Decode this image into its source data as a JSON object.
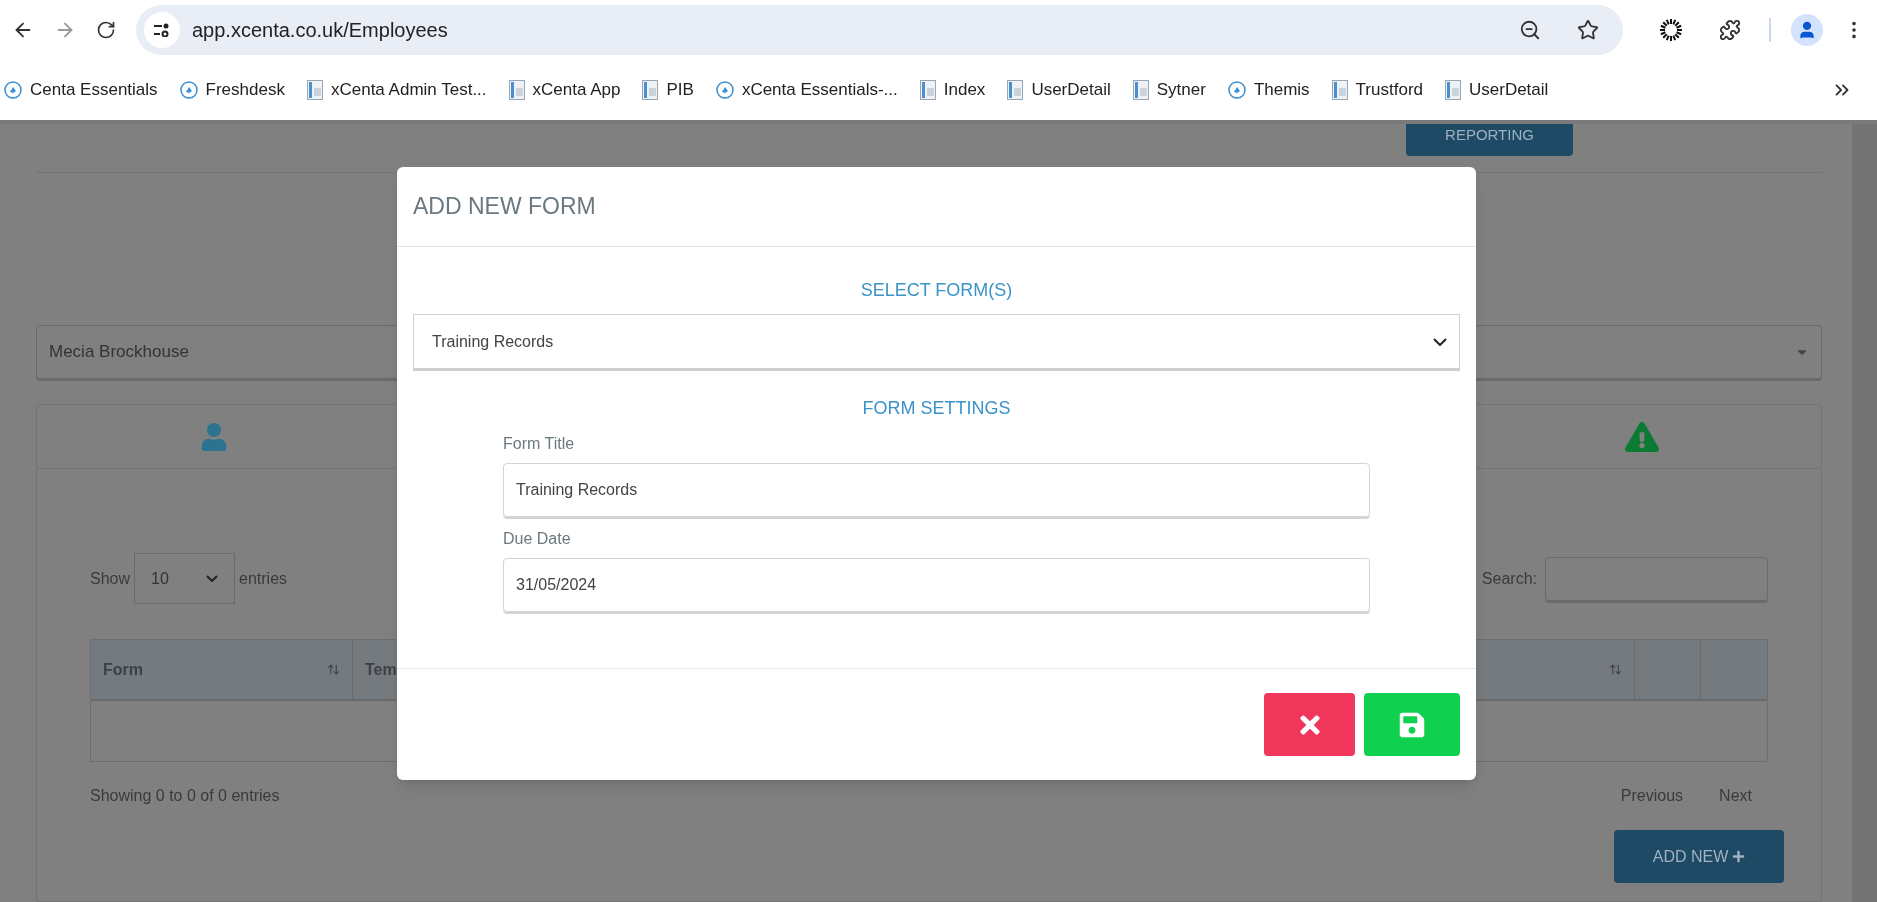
{
  "browser": {
    "url": "app.xcenta.co.uk/Employees",
    "bookmarks": [
      {
        "label": "Centa Essentials",
        "kind": "site"
      },
      {
        "label": "Freshdesk",
        "kind": "site"
      },
      {
        "label": "xCenta Admin Test...",
        "kind": "page"
      },
      {
        "label": "xCenta App",
        "kind": "page"
      },
      {
        "label": "PIB",
        "kind": "page"
      },
      {
        "label": "xCenta Essentials-...",
        "kind": "site"
      },
      {
        "label": "Index",
        "kind": "page"
      },
      {
        "label": "UserDetail",
        "kind": "page"
      },
      {
        "label": "Sytner",
        "kind": "page"
      },
      {
        "label": "Themis",
        "kind": "site"
      },
      {
        "label": "Trustford",
        "kind": "page"
      },
      {
        "label": "UserDetail",
        "kind": "page"
      }
    ]
  },
  "page": {
    "reporting_button": "REPORTING",
    "employee_select": "Mecia Brockhouse",
    "table": {
      "show_label": "Show",
      "page_size": "10",
      "entries_label": "entries",
      "search_label": "Search:",
      "columns": [
        {
          "label": "Form"
        },
        {
          "label": "Tem"
        }
      ],
      "info": "Showing 0 to 0 of 0 entries",
      "previous": "Previous",
      "next": "Next"
    },
    "add_new": "ADD NEW"
  },
  "modal": {
    "title": "ADD NEW FORM",
    "select_heading": "SELECT FORM(S)",
    "selected_form": "Training Records",
    "settings_heading": "FORM SETTINGS",
    "fields": [
      {
        "label": "Form Title",
        "value": "Training Records"
      },
      {
        "label": "Due Date",
        "value": "31/05/2024"
      }
    ]
  }
}
